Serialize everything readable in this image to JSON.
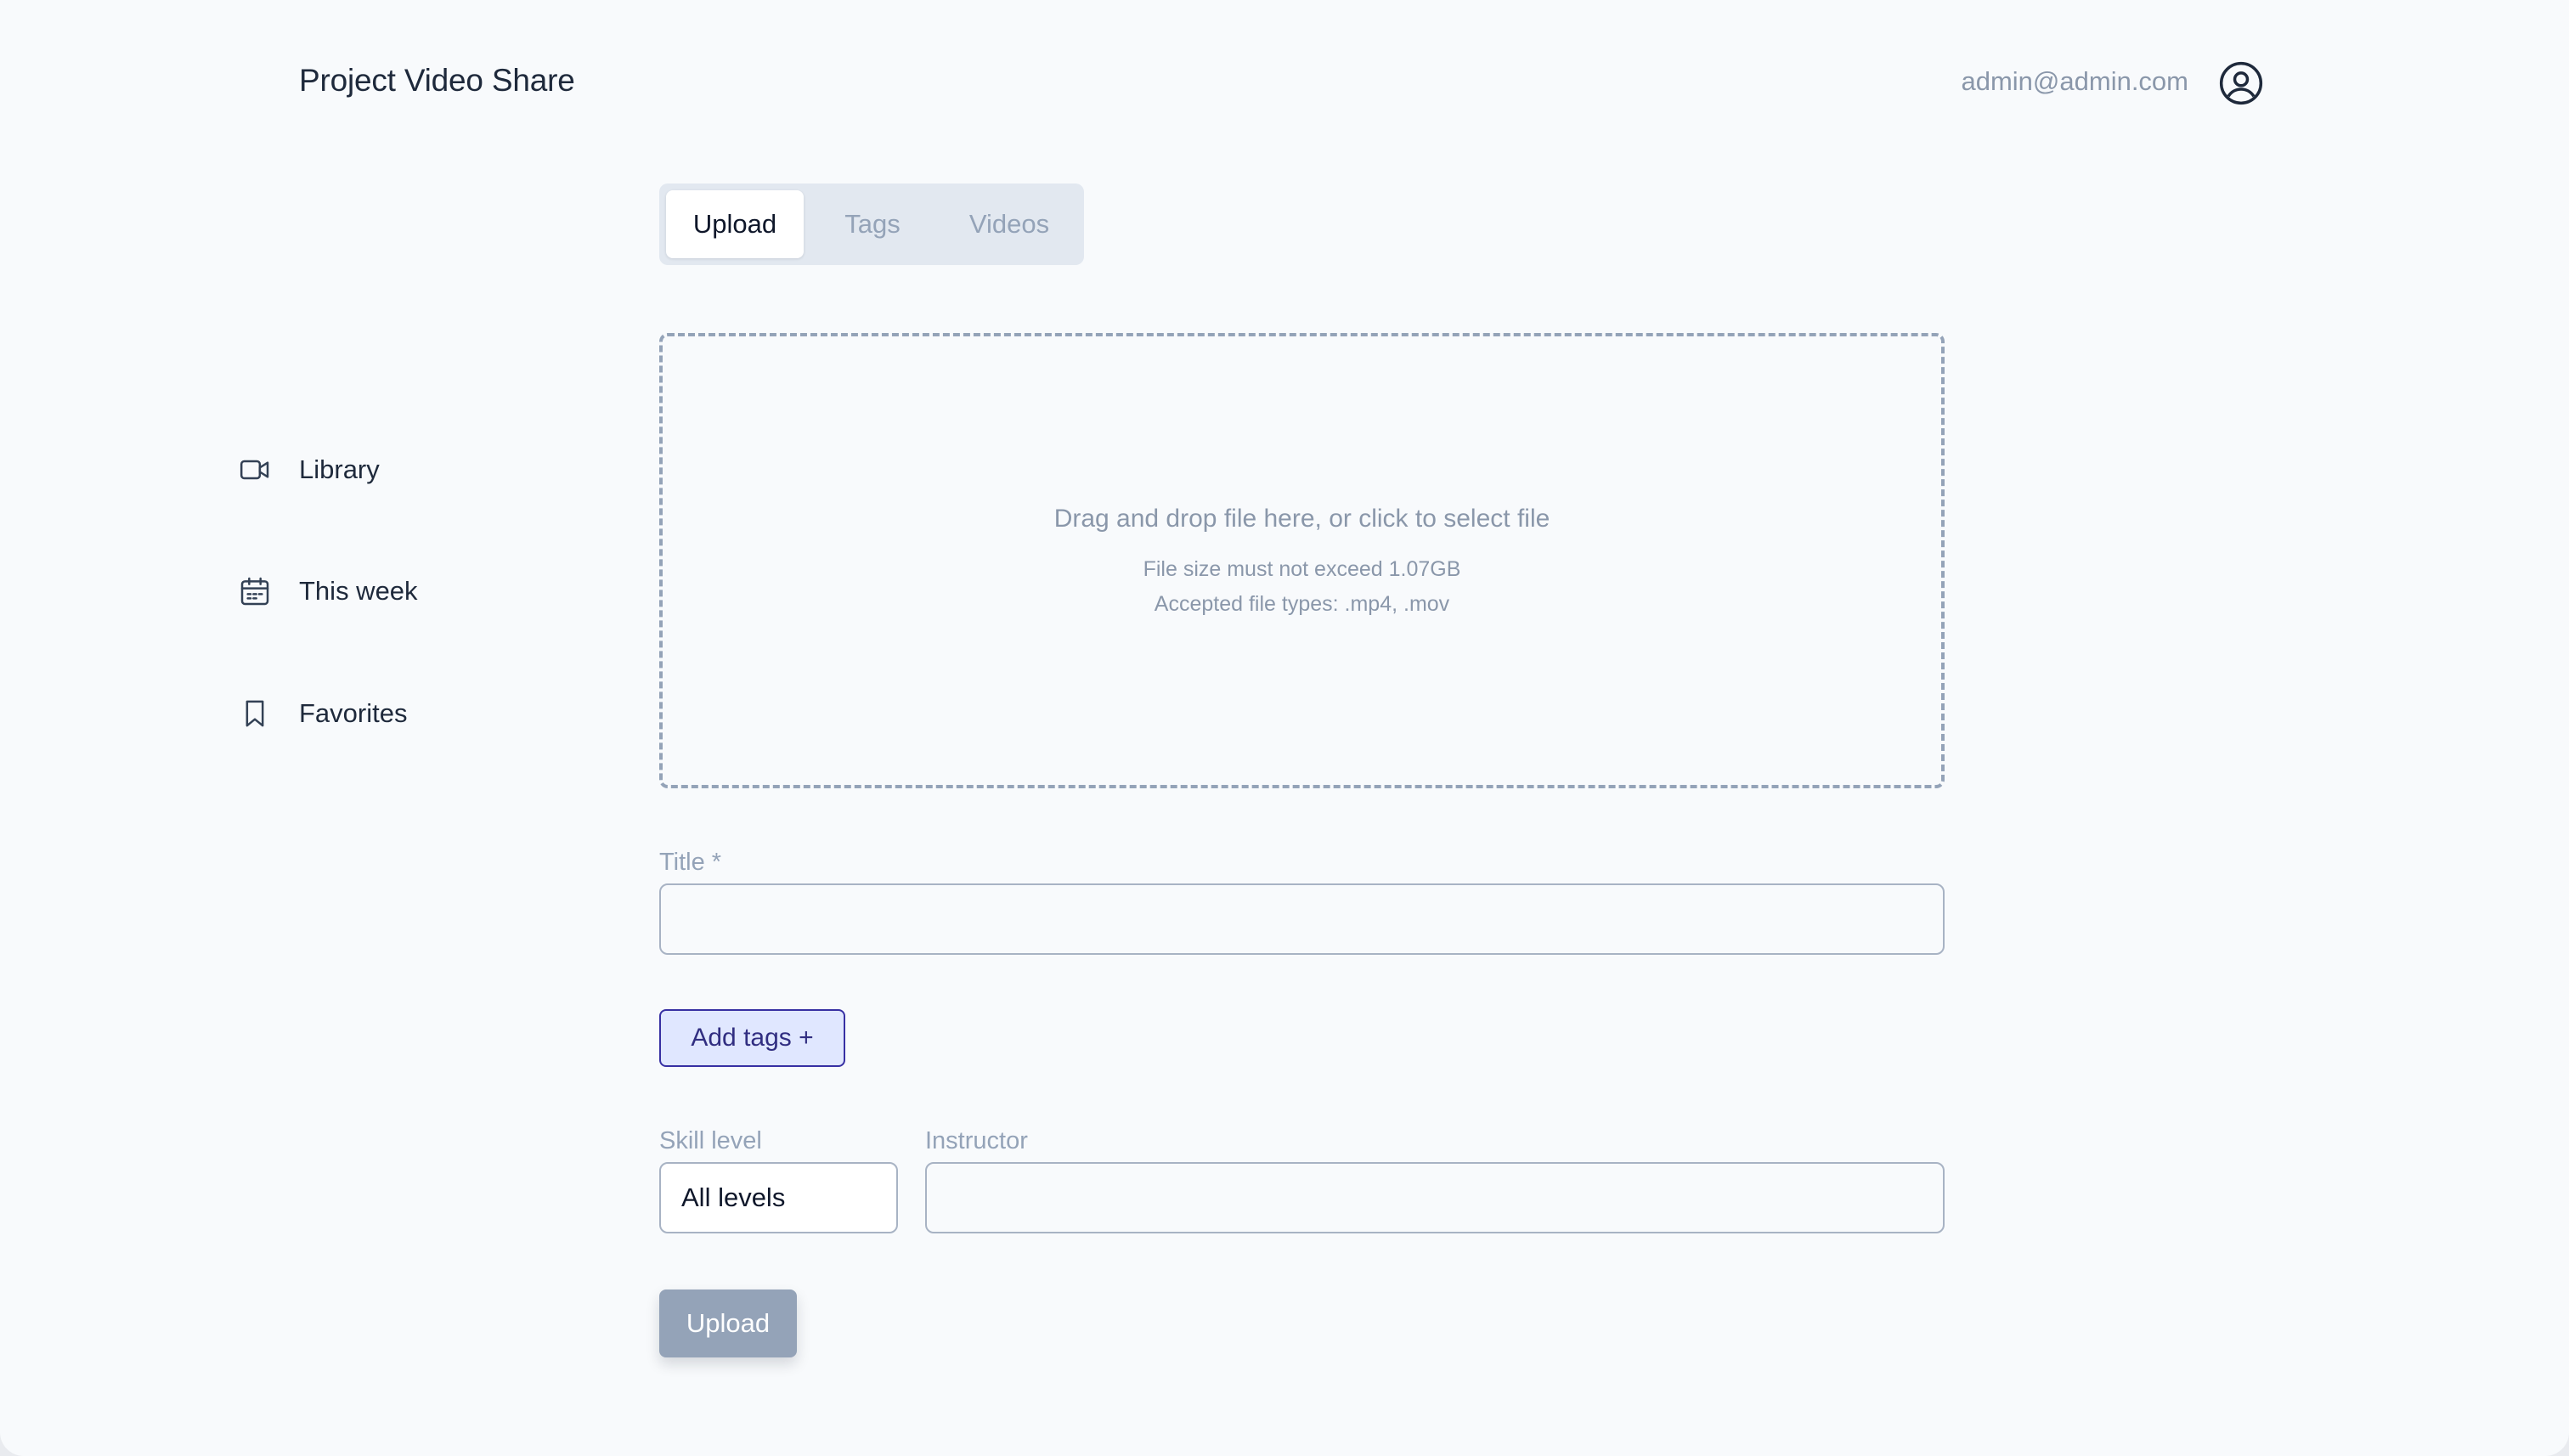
{
  "app": {
    "title": "Project Video Share",
    "user_email": "admin@admin.com"
  },
  "sidebar": {
    "items": [
      {
        "label": "Library",
        "icon": "video-icon"
      },
      {
        "label": "This week",
        "icon": "calendar-icon"
      },
      {
        "label": "Favorites",
        "icon": "bookmark-icon"
      }
    ]
  },
  "tabs": [
    {
      "label": "Upload",
      "active": true
    },
    {
      "label": "Tags",
      "active": false
    },
    {
      "label": "Videos",
      "active": false
    }
  ],
  "dropzone": {
    "main": "Drag and drop file here, or click to select file",
    "size_limit": "File size must not exceed 1.07GB",
    "types": "Accepted file types: .mp4, .mov"
  },
  "form": {
    "title_label": "Title *",
    "title_value": "",
    "add_tags_label": "Add tags +",
    "skill_label": "Skill level",
    "skill_value": "All levels",
    "instructor_label": "Instructor",
    "instructor_value": "",
    "submit_label": "Upload"
  },
  "colors": {
    "background": "#f8fafc",
    "text": "#1e293b",
    "muted": "#94a3b8",
    "accent": "#3730a3",
    "accent_bg": "#e0e7ff"
  }
}
